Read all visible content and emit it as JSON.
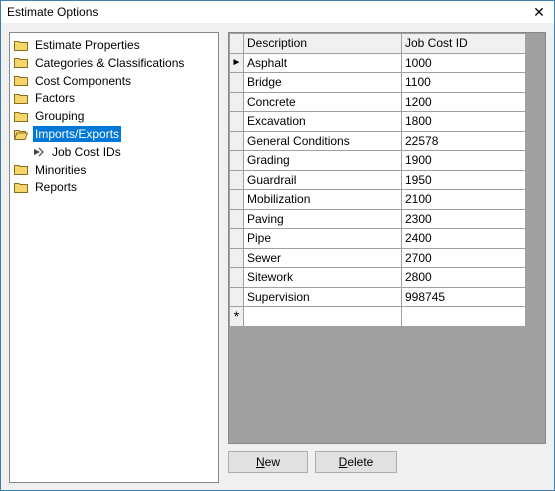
{
  "window": {
    "title": "Estimate Options",
    "close_glyph": "✕"
  },
  "tree": {
    "items": [
      {
        "label": "Estimate Properties",
        "icon": "folder-icon"
      },
      {
        "label": "Categories & Classifications",
        "icon": "folder-icon"
      },
      {
        "label": "Cost Components",
        "icon": "folder-icon"
      },
      {
        "label": "Factors",
        "icon": "folder-icon"
      },
      {
        "label": "Grouping",
        "icon": "folder-icon"
      },
      {
        "label": "Imports/Exports",
        "icon": "folder-open-icon",
        "selected": true
      },
      {
        "label": "Job Cost IDs",
        "icon": "bullet-arrow-icon",
        "child": true
      },
      {
        "label": "Minorities",
        "icon": "folder-icon"
      },
      {
        "label": "Reports",
        "icon": "folder-icon"
      }
    ]
  },
  "grid": {
    "columns": [
      "Description",
      "Job Cost ID"
    ],
    "current_row_marker": "►",
    "new_row_marker": "*",
    "rows": [
      {
        "description": "Asphalt",
        "job_cost_id": "1000"
      },
      {
        "description": "Bridge",
        "job_cost_id": "1100"
      },
      {
        "description": "Concrete",
        "job_cost_id": "1200"
      },
      {
        "description": "Excavation",
        "job_cost_id": "1800"
      },
      {
        "description": "General Conditions",
        "job_cost_id": "22578"
      },
      {
        "description": "Grading",
        "job_cost_id": "1900"
      },
      {
        "description": "Guardrail",
        "job_cost_id": "1950"
      },
      {
        "description": "Mobilization",
        "job_cost_id": "2100"
      },
      {
        "description": "Paving",
        "job_cost_id": "2300"
      },
      {
        "description": "Pipe",
        "job_cost_id": "2400"
      },
      {
        "description": "Sewer",
        "job_cost_id": "2700"
      },
      {
        "description": "Sitework",
        "job_cost_id": "2800"
      },
      {
        "description": "Supervision",
        "job_cost_id": "998745"
      }
    ]
  },
  "buttons": {
    "new": {
      "mnemonic": "N",
      "rest": "ew"
    },
    "delete": {
      "mnemonic": "D",
      "rest": "elete"
    }
  },
  "colors": {
    "selection": "#0078d7",
    "folder": "#f5d66b",
    "grid_empty": "#a0a0a0"
  }
}
